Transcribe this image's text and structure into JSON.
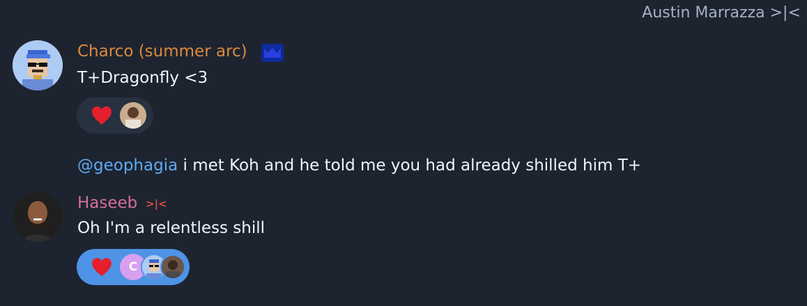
{
  "header": {
    "peer_name": "Austin Marrazza >|< i"
  },
  "messages": [
    {
      "sender": "Charco (summer arc)",
      "sender_color": "#dd8a3e",
      "badge_icon": "crown-icon",
      "text": "T+Dragonfly <3",
      "reactions": [
        {
          "emoji": "❤️",
          "icon": "heart-icon"
        }
      ]
    },
    {
      "mention": "@geophagia",
      "text": " i met Koh and he told me you had already shilled him T+"
    },
    {
      "sender": "Haseeb",
      "sender_color": "#d66e98",
      "sender_tag": ">|<",
      "text": "Oh I'm a relentless shill",
      "reactions": [
        {
          "emoji": "❤️",
          "icon": "heart-icon",
          "initial": "C"
        }
      ]
    }
  ]
}
